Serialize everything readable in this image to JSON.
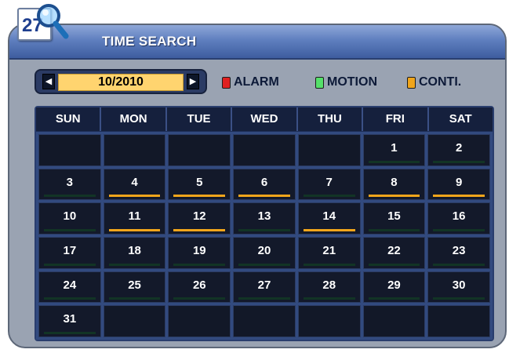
{
  "window": {
    "title": "TIME SEARCH",
    "icon_day": "27"
  },
  "month_selector": {
    "value": "10/2010",
    "prev_icon": "left-arrow-icon",
    "next_icon": "right-arrow-icon"
  },
  "legend": [
    {
      "label": "ALARM",
      "color": "#e02020"
    },
    {
      "label": "MOTION",
      "color": "#55e06a"
    },
    {
      "label": "CONTI.",
      "color": "#f0a51b"
    }
  ],
  "calendar": {
    "weekdays": [
      "SUN",
      "MON",
      "TUE",
      "WED",
      "THU",
      "FRI",
      "SAT"
    ],
    "cells": [
      {
        "day": "",
        "rec": ""
      },
      {
        "day": "",
        "rec": ""
      },
      {
        "day": "",
        "rec": ""
      },
      {
        "day": "",
        "rec": ""
      },
      {
        "day": "",
        "rec": ""
      },
      {
        "day": "1",
        "rec": "none"
      },
      {
        "day": "2",
        "rec": "none"
      },
      {
        "day": "3",
        "rec": "none"
      },
      {
        "day": "4",
        "rec": "cont"
      },
      {
        "day": "5",
        "rec": "cont"
      },
      {
        "day": "6",
        "rec": "cont"
      },
      {
        "day": "7",
        "rec": "none"
      },
      {
        "day": "8",
        "rec": "cont"
      },
      {
        "day": "9",
        "rec": "cont"
      },
      {
        "day": "10",
        "rec": "none"
      },
      {
        "day": "11",
        "rec": "cont"
      },
      {
        "day": "12",
        "rec": "cont"
      },
      {
        "day": "13",
        "rec": "none"
      },
      {
        "day": "14",
        "rec": "cont"
      },
      {
        "day": "15",
        "rec": "none"
      },
      {
        "day": "16",
        "rec": "none"
      },
      {
        "day": "17",
        "rec": "none"
      },
      {
        "day": "18",
        "rec": "none"
      },
      {
        "day": "19",
        "rec": "none"
      },
      {
        "day": "20",
        "rec": "none"
      },
      {
        "day": "21",
        "rec": "none"
      },
      {
        "day": "22",
        "rec": "none"
      },
      {
        "day": "23",
        "rec": "none"
      },
      {
        "day": "24",
        "rec": "none"
      },
      {
        "day": "25",
        "rec": "none"
      },
      {
        "day": "26",
        "rec": "none"
      },
      {
        "day": "27",
        "rec": "none"
      },
      {
        "day": "28",
        "rec": "none"
      },
      {
        "day": "29",
        "rec": "none"
      },
      {
        "day": "30",
        "rec": "none"
      },
      {
        "day": "31",
        "rec": "none"
      },
      {
        "day": "",
        "rec": ""
      },
      {
        "day": "",
        "rec": ""
      },
      {
        "day": "",
        "rec": ""
      },
      {
        "day": "",
        "rec": ""
      },
      {
        "day": "",
        "rec": ""
      },
      {
        "day": "",
        "rec": ""
      }
    ]
  }
}
